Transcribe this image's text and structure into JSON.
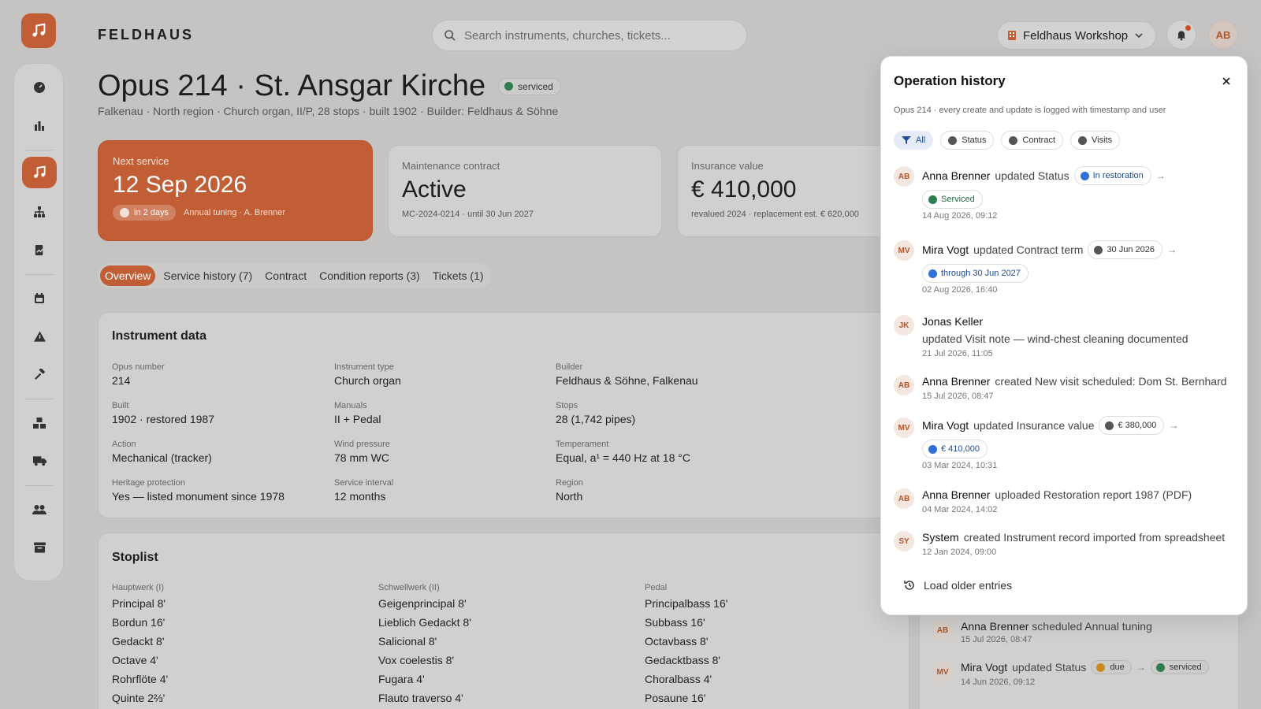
{
  "brand": "FELDHAUS",
  "search": {
    "placeholder": "Search instruments, churches, tickets..."
  },
  "workspace": {
    "label": "Feldhaus Workshop"
  },
  "user": {
    "initials": "AB"
  },
  "colors": {
    "accent": "#c25e36",
    "serviced": "#2e7d4f",
    "restoration": "#2f6fd6",
    "neutral": "#555555",
    "due": "#c98a1e"
  },
  "instrument": {
    "title": "Opus 214 · St. Ansgar Kirche",
    "status": "serviced",
    "subtitle": "Falkenau · North region · Church organ, II/P, 28 stops · built 1902 · Builder: Feldhaus & Söhne"
  },
  "kpis": {
    "next_service": {
      "label": "Next service",
      "value": "12 Sep 2026",
      "badge": "in 2 days",
      "sub": "Annual tuning · A. Brenner"
    },
    "contract": {
      "label": "Maintenance contract",
      "value": "Active",
      "sub": "MC-2024-0214 · until 30 Jun 2027"
    },
    "insurance": {
      "label": "Insurance value",
      "value": "€ 410,000",
      "sub": "revalued 2024 · replacement est. € 620,000"
    }
  },
  "tabs": [
    "Overview",
    "Service history (7)",
    "Contract",
    "Condition reports (3)",
    "Tickets (1)"
  ],
  "instrument_data": {
    "heading": "Instrument data",
    "fields": [
      {
        "label": "Opus number",
        "value": "214"
      },
      {
        "label": "Instrument type",
        "value": "Church organ"
      },
      {
        "label": "Builder",
        "value": "Feldhaus & Söhne, Falkenau"
      },
      {
        "label": "Built",
        "value": "1902 · restored 1987"
      },
      {
        "label": "Manuals",
        "value": "II + Pedal"
      },
      {
        "label": "Stops",
        "value": "28 (1,742 pipes)"
      },
      {
        "label": "Action",
        "value": "Mechanical (tracker)"
      },
      {
        "label": "Wind pressure",
        "value": "78 mm WC"
      },
      {
        "label": "Temperament",
        "value": "Equal, a¹ = 440 Hz at 18 °C"
      },
      {
        "label": "Heritage protection",
        "value": "Yes — listed monument since 1978"
      },
      {
        "label": "Service interval",
        "value": "12 months"
      },
      {
        "label": "Region",
        "value": "North"
      }
    ]
  },
  "stoplist": {
    "heading": "Stoplist",
    "divisions": [
      {
        "name": "Hauptwerk (I)",
        "stops": [
          "Principal 8'",
          "Bordun 16'",
          "Gedackt 8'",
          "Octave 4'",
          "Rohrflöte 4'",
          "Quinte 2⅔'"
        ]
      },
      {
        "name": "Schwellwerk (II)",
        "stops": [
          "Geigenprincipal 8'",
          "Lieblich Gedackt 8'",
          "Salicional 8'",
          "Vox coelestis 8'",
          "Fugara 4'",
          "Flauto traverso 4'"
        ]
      },
      {
        "name": "Pedal",
        "stops": [
          "Principalbass 16'",
          "Subbass 16'",
          "Octavbass 8'",
          "Gedacktbass 8'",
          "Choralbass 4'",
          "Posaune 16'"
        ]
      }
    ]
  },
  "history_panel": {
    "title": "Operation history",
    "subtitle": "Opus 214 · every create and update is logged with timestamp and user",
    "filters": [
      "All",
      "Status",
      "Contract",
      "Visits"
    ],
    "entries": [
      {
        "initials": "AB",
        "user": "Anna Brenner",
        "action": "updated Status",
        "from": "In restoration",
        "to": "Serviced",
        "time": "14 Aug 2026, 09:12"
      },
      {
        "initials": "MV",
        "user": "Mira Vogt",
        "action": "updated Contract term",
        "from": "30 Jun 2026",
        "to": "through 30 Jun 2027",
        "time": "02 Aug 2026, 16:40"
      },
      {
        "initials": "JK",
        "user": "Jonas Keller",
        "action": "updated Visit note — wind-chest cleaning documented",
        "time": "21 Jul 2026, 11:05"
      },
      {
        "initials": "AB",
        "user": "Anna Brenner",
        "action": "created New visit scheduled: Dom St. Bernhard",
        "time": "15 Jul 2026, 08:47"
      },
      {
        "initials": "MV",
        "user": "Mira Vogt",
        "action": "updated Insurance value",
        "from": "€ 380,000",
        "to": "€ 410,000",
        "time": "03 Mar 2024, 10:31"
      },
      {
        "initials": "AB",
        "user": "Anna Brenner",
        "action": "uploaded Restoration report 1987 (PDF)",
        "time": "04 Mar 2024, 14:02"
      },
      {
        "initials": "SY",
        "user": "System",
        "action": "created Instrument record imported from spreadsheet",
        "time": "12 Jan 2024, 09:00"
      }
    ],
    "load_older": "Load older entries"
  },
  "background_activity": [
    {
      "initials": "AB",
      "user": "Anna Brenner",
      "action": "scheduled Annual tuning",
      "time": "15 Jul 2026, 08:47"
    },
    {
      "initials": "MV",
      "user": "Mira Vogt",
      "action": "updated Status",
      "from": "due",
      "to": "serviced",
      "time": "14 Jun 2026, 09:12"
    }
  ]
}
